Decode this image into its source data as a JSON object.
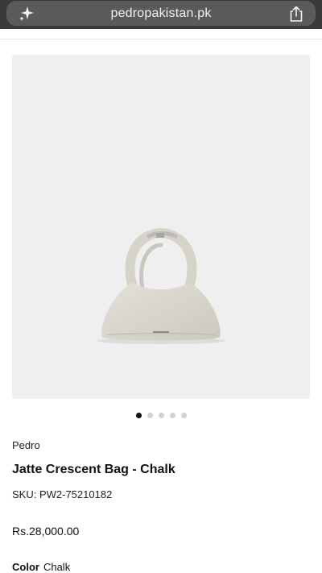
{
  "browser": {
    "url": "pedropakistan.pk",
    "left_icon": "sparkle-icon",
    "right_icon": "share-icon"
  },
  "carousel": {
    "total": 5,
    "active_index": 0
  },
  "product": {
    "brand": "Pedro",
    "title": "Jatte Crescent Bag - Chalk",
    "sku": "SKU: PW2-75210182",
    "price": "Rs.28,000.00",
    "color_label": "Color",
    "color_value": "Chalk"
  },
  "colors": {
    "image_background": "#efefef",
    "bag": "#dcd9d2",
    "active_dot": "#111111",
    "inactive_dot": "#d2d2d2"
  }
}
